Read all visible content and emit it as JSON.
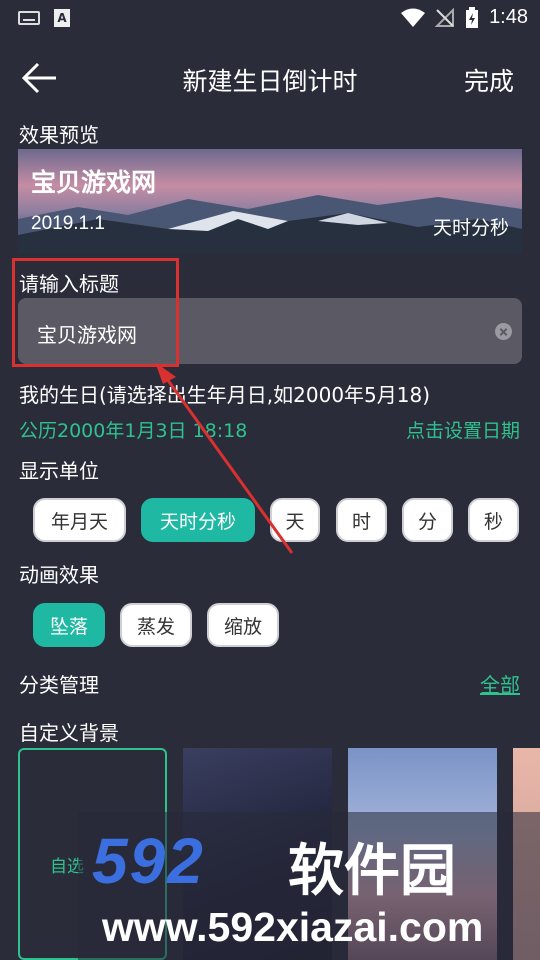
{
  "status_bar": {
    "time": "1:48"
  },
  "header": {
    "title": "新建生日倒计时",
    "done_label": "完成"
  },
  "preview": {
    "section_label": "效果预览",
    "name": "宝贝游戏网",
    "date": "2019.1.1",
    "unit": "天时分秒"
  },
  "title_field": {
    "label": "请输入标题",
    "value": "宝贝游戏网"
  },
  "birthday": {
    "label": "我的生日(请选择出生年月日,如2000年5月18)",
    "value": "公历2000年1月3日 18:18",
    "set_date_label": "点击设置日期"
  },
  "display_unit": {
    "label": "显示单位",
    "options": [
      "年月天",
      "天时分秒",
      "天",
      "时",
      "分",
      "秒"
    ],
    "selected": "天时分秒"
  },
  "animation": {
    "label": "动画效果",
    "options": [
      "坠落",
      "蒸发",
      "缩放"
    ],
    "selected": "坠落"
  },
  "category": {
    "label": "分类管理",
    "all_label": "全部"
  },
  "background": {
    "label": "自定义背景",
    "custom_label": "自选"
  },
  "watermark": {
    "logo": "592",
    "name": "软件园",
    "url": "www.592xiazai.com"
  },
  "colors": {
    "background": "#2b2c3a",
    "accent": "#2ec28f",
    "chip_active": "#1fb8a3",
    "annotation": "#d9312f"
  }
}
